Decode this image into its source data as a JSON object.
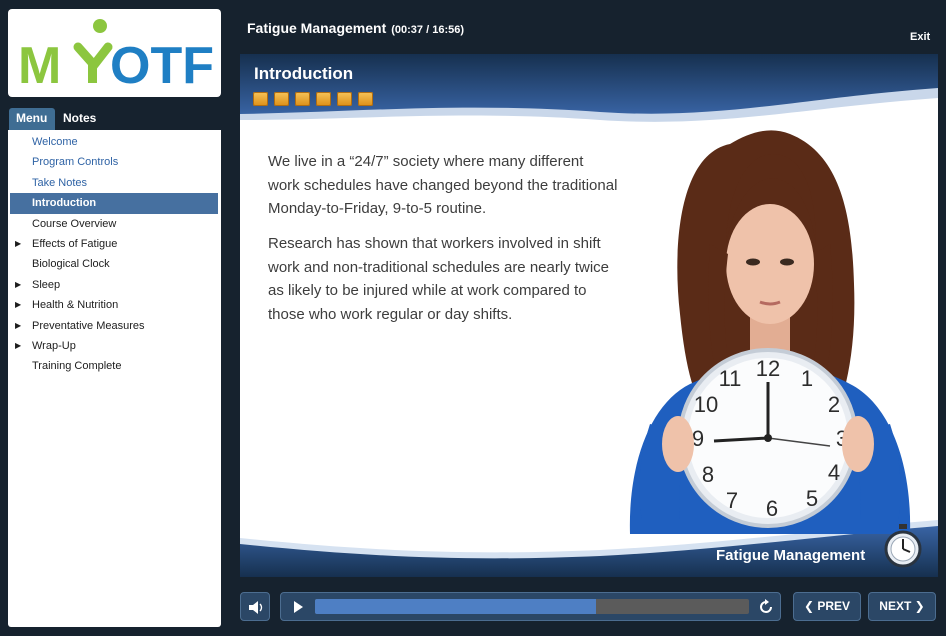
{
  "logo": {
    "text_left": "M",
    "text_right": "OTF"
  },
  "tabs": {
    "menu": "Menu",
    "notes": "Notes"
  },
  "menu": {
    "items": [
      {
        "label": "Welcome",
        "state": "link",
        "expandable": false
      },
      {
        "label": "Program Controls",
        "state": "link",
        "expandable": false
      },
      {
        "label": "Take Notes",
        "state": "link",
        "expandable": false
      },
      {
        "label": "Introduction",
        "state": "active",
        "expandable": false
      },
      {
        "label": "Course Overview",
        "state": "normal",
        "expandable": false
      },
      {
        "label": "Effects of Fatigue",
        "state": "normal",
        "expandable": true
      },
      {
        "label": "Biological Clock",
        "state": "normal",
        "expandable": false
      },
      {
        "label": "Sleep",
        "state": "normal",
        "expandable": true
      },
      {
        "label": "Health & Nutrition",
        "state": "normal",
        "expandable": true
      },
      {
        "label": "Preventative Measures",
        "state": "normal",
        "expandable": true
      },
      {
        "label": "Wrap-Up",
        "state": "normal",
        "expandable": true
      },
      {
        "label": "Training Complete",
        "state": "normal",
        "expandable": false
      }
    ]
  },
  "header": {
    "course_title": "Fatigue Management",
    "time": "(00:37 / 16:56)",
    "exit_label": "Exit"
  },
  "slide": {
    "heading": "Introduction",
    "progress_boxes": 6,
    "paragraph_1": "We live in a “24/7” society where many different work schedules have changed beyond the traditional Monday-to-Friday, 9-to-5 routine.",
    "paragraph_2": "Research has shown that workers involved in shift work and non-traditional schedules are nearly twice as likely to be injured while at work compared to those who work regular or day shifts.",
    "footer_title": "Fatigue Management"
  },
  "controls": {
    "playback_progress": 0.647,
    "prev_label": "PREV",
    "next_label": "NEXT"
  },
  "icons": {
    "volume": "speaker-icon",
    "play": "play-icon",
    "replay": "replay-icon",
    "prev": "chevron-left-icon",
    "next": "chevron-right-icon",
    "expand": "triangle-right-icon"
  },
  "colors": {
    "background": "#16222e",
    "accent": "#3f6d93",
    "active_item": "#4670a0",
    "link": "#2f63a5",
    "logo_green": "#8cc63f",
    "logo_blue": "#1f7fc4",
    "seek_fill": "#4e7fc4"
  }
}
